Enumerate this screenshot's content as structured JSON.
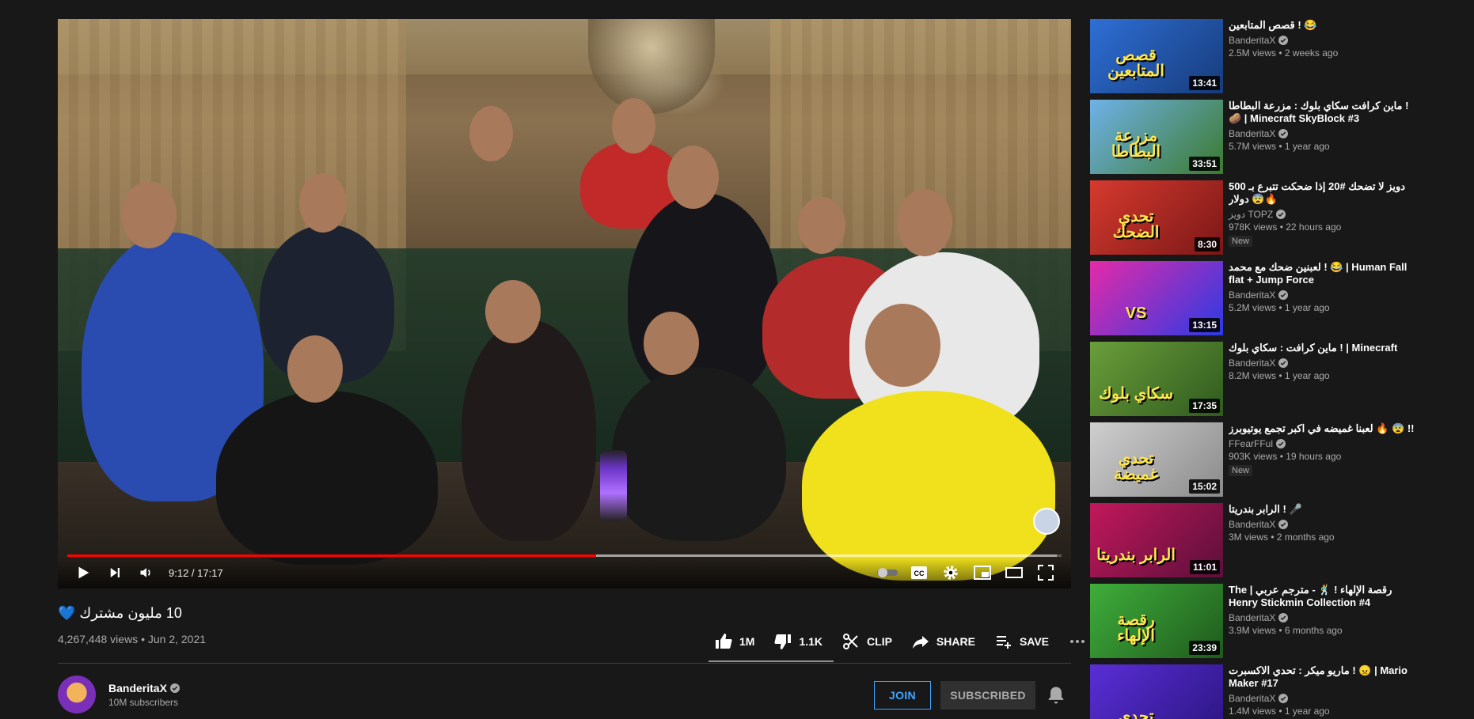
{
  "player": {
    "time": "9:12 / 17:17",
    "progress_fraction": 0.532,
    "loaded_fraction": 0.995
  },
  "video": {
    "title": "10 مليون مشترك 💙",
    "views_date": "4,267,448 views • Jun 2, 2021"
  },
  "actions": {
    "like": "1M",
    "dislike": "1.1K",
    "clip": "CLIP",
    "share": "SHARE",
    "save": "SAVE"
  },
  "owner": {
    "name": "BanderitaX",
    "subscribers": "10M subscribers",
    "join": "JOIN",
    "subscribed": "SUBSCRIBED"
  },
  "recommendations": [
    {
      "title": "قصص المتابعين ! 😂",
      "channel": "BanderitaX",
      "views": "2.5M views • 2 weeks ago",
      "duration": "13:41",
      "badge": "",
      "thumb_text": "قصص المتابعين",
      "colors": [
        "#2e6fd6",
        "#173b7a"
      ]
    },
    {
      "title": "ماين كرافت سكاي بلوك : مزرعة البطاطا ! 🥔 | Minecraft SkyBlock #3",
      "channel": "BanderitaX",
      "views": "5.7M views • 1 year ago",
      "duration": "33:51",
      "badge": "",
      "thumb_text": "مزرعة البطاطا",
      "colors": [
        "#6fb2e8",
        "#3b7a2e"
      ]
    },
    {
      "title": "دويز لا تضحك #20 إذا ضحكت تتبرع بـ 500 دولار 😨🔥",
      "channel": "دويز TOPZ",
      "views": "978K views • 22 hours ago",
      "duration": "8:30",
      "badge": "New",
      "thumb_text": "تحدي الضحك",
      "colors": [
        "#d63a2e",
        "#7a1717"
      ]
    },
    {
      "title": "لعبنين ضحك مع محمد ! 😂 | Human Fall flat + Jump Force",
      "channel": "BanderitaX",
      "views": "5.2M views • 1 year ago",
      "duration": "13:15",
      "badge": "",
      "thumb_text": "VS",
      "colors": [
        "#e52aa8",
        "#2a3be5"
      ]
    },
    {
      "title": "ماين كرافت : سكاي بلوك ! | Minecraft",
      "channel": "BanderitaX",
      "views": "8.2M views • 1 year ago",
      "duration": "17:35",
      "badge": "",
      "thumb_text": "سكاي بلوك",
      "colors": [
        "#6a9e3a",
        "#2f5a1e"
      ]
    },
    {
      "title": "لعبنا غميضه في اكبر تجمع يوتيوبرز 🔥 😨 !!",
      "channel": "FFearFFul",
      "views": "903K views • 19 hours ago",
      "duration": "15:02",
      "badge": "New",
      "thumb_text": "تحدي غميضة",
      "colors": [
        "#cfcfcf",
        "#8a8a8a"
      ]
    },
    {
      "title": "الرابر بندريتا ! 🎤",
      "channel": "BanderitaX",
      "views": "3M views • 2 months ago",
      "duration": "11:01",
      "badge": "",
      "thumb_text": "الرابر بندريتا",
      "colors": [
        "#c2185b",
        "#5a0f3a"
      ]
    },
    {
      "title": "The | رقصة الإلهاء ! 🕺 - مترجم عربي Henry Stickmin Collection #4",
      "channel": "BanderitaX",
      "views": "3.9M views • 6 months ago",
      "duration": "23:39",
      "badge": "",
      "thumb_text": "رقصة الإلهاء",
      "colors": [
        "#3fae3a",
        "#1f5a1d"
      ]
    },
    {
      "title": "ماريو ميكر : تحدي الاكسبرت ! 😠 | Mario Maker #17",
      "channel": "BanderitaX",
      "views": "1.4M views • 1 year ago",
      "duration": "",
      "badge": "",
      "thumb_text": "تحدي",
      "colors": [
        "#5a2ed6",
        "#2a1580"
      ]
    }
  ]
}
